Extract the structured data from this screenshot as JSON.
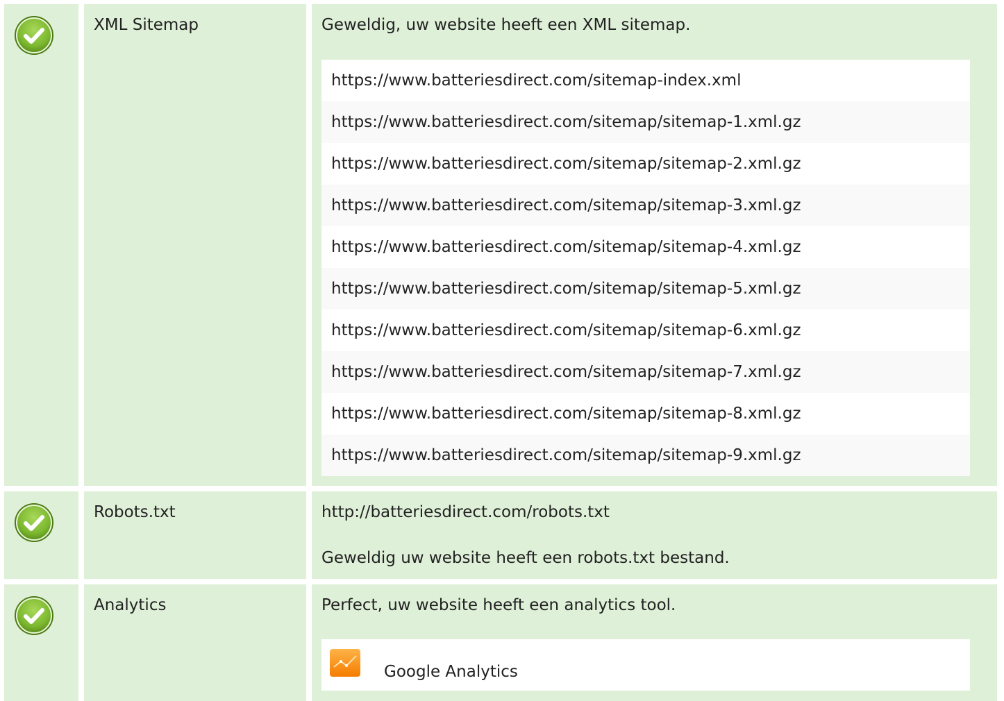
{
  "status_colors": {
    "pass": "#8dc63f",
    "row_background": "#dff0d8"
  },
  "checks": [
    {
      "label": "XML Sitemap",
      "message": "Geweldig, uw website heeft een XML sitemap.",
      "icon": "check-circle-icon",
      "sitemaps": [
        "https://www.batteriesdirect.com/sitemap-index.xml",
        "https://www.batteriesdirect.com/sitemap/sitemap-1.xml.gz",
        "https://www.batteriesdirect.com/sitemap/sitemap-2.xml.gz",
        "https://www.batteriesdirect.com/sitemap/sitemap-3.xml.gz",
        "https://www.batteriesdirect.com/sitemap/sitemap-4.xml.gz",
        "https://www.batteriesdirect.com/sitemap/sitemap-5.xml.gz",
        "https://www.batteriesdirect.com/sitemap/sitemap-6.xml.gz",
        "https://www.batteriesdirect.com/sitemap/sitemap-7.xml.gz",
        "https://www.batteriesdirect.com/sitemap/sitemap-8.xml.gz",
        "https://www.batteriesdirect.com/sitemap/sitemap-9.xml.gz"
      ]
    },
    {
      "label": "Robots.txt",
      "url": "http://batteriesdirect.com/robots.txt",
      "message": "Geweldig uw website heeft een robots.txt bestand.",
      "icon": "check-circle-icon"
    },
    {
      "label": "Analytics",
      "message": "Perfect, uw website heeft een analytics tool.",
      "icon": "check-circle-icon",
      "tool": {
        "name": "Google Analytics",
        "icon": "google-analytics-icon"
      }
    }
  ]
}
